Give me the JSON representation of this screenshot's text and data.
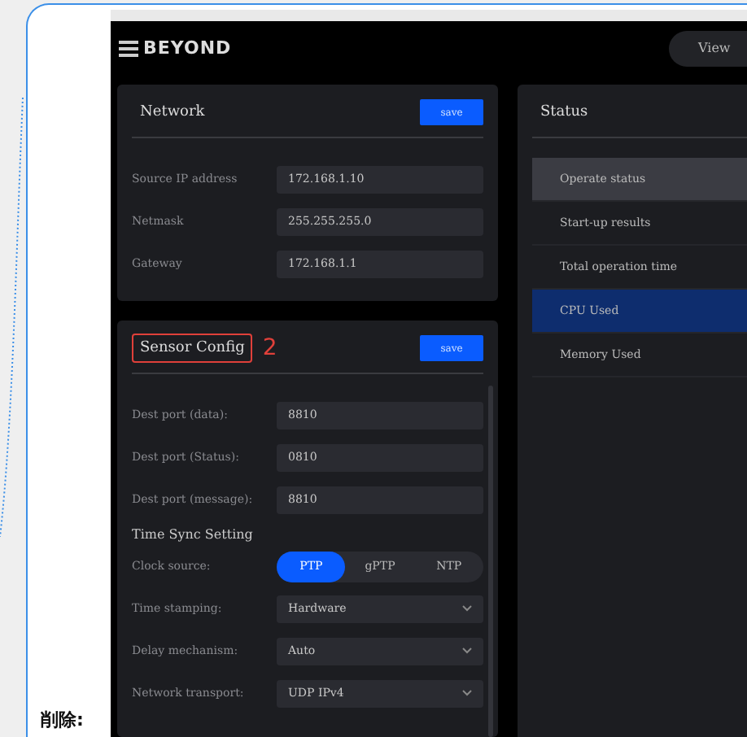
{
  "app": {
    "logo": "BEYOND",
    "view_button": "View"
  },
  "network": {
    "title": "Network",
    "save": "save",
    "fields": [
      {
        "label": "Source IP address",
        "value": "172.168.1.10"
      },
      {
        "label": "Netmask",
        "value": "255.255.255.0"
      },
      {
        "label": "Gateway",
        "value": "172.168.1.1"
      }
    ]
  },
  "sensor_config": {
    "title": "Sensor Config",
    "title_highlighted": true,
    "annotation": "2",
    "save": "save",
    "fields": [
      {
        "label": "Dest port (data):",
        "value": "8810"
      },
      {
        "label": "Dest port (Status):",
        "value": "0810"
      },
      {
        "label": "Dest port (message):",
        "value": "8810"
      }
    ],
    "section": "Time Sync Setting",
    "clock_source": {
      "label": "Clock source:",
      "options": [
        {
          "label": "PTP",
          "selected": true
        },
        {
          "label": "gPTP",
          "selected": false
        },
        {
          "label": "NTP",
          "selected": false
        }
      ]
    },
    "selects": [
      {
        "label": "Time stamping:",
        "value": "Hardware"
      },
      {
        "label": "Delay mechanism:",
        "value": "Auto"
      },
      {
        "label": "Network transport:",
        "value": "UDP IPv4"
      }
    ]
  },
  "status": {
    "title": "Status",
    "items": [
      {
        "label": "Operate status",
        "hovered": true,
        "selected": false
      },
      {
        "label": "Start-up results",
        "hovered": false,
        "selected": false
      },
      {
        "label": "Total operation time",
        "hovered": false,
        "selected": false
      },
      {
        "label": "CPU Used",
        "hovered": false,
        "selected": true
      },
      {
        "label": "Memory Used",
        "hovered": false,
        "selected": false
      }
    ]
  },
  "side_label": "削除:"
}
